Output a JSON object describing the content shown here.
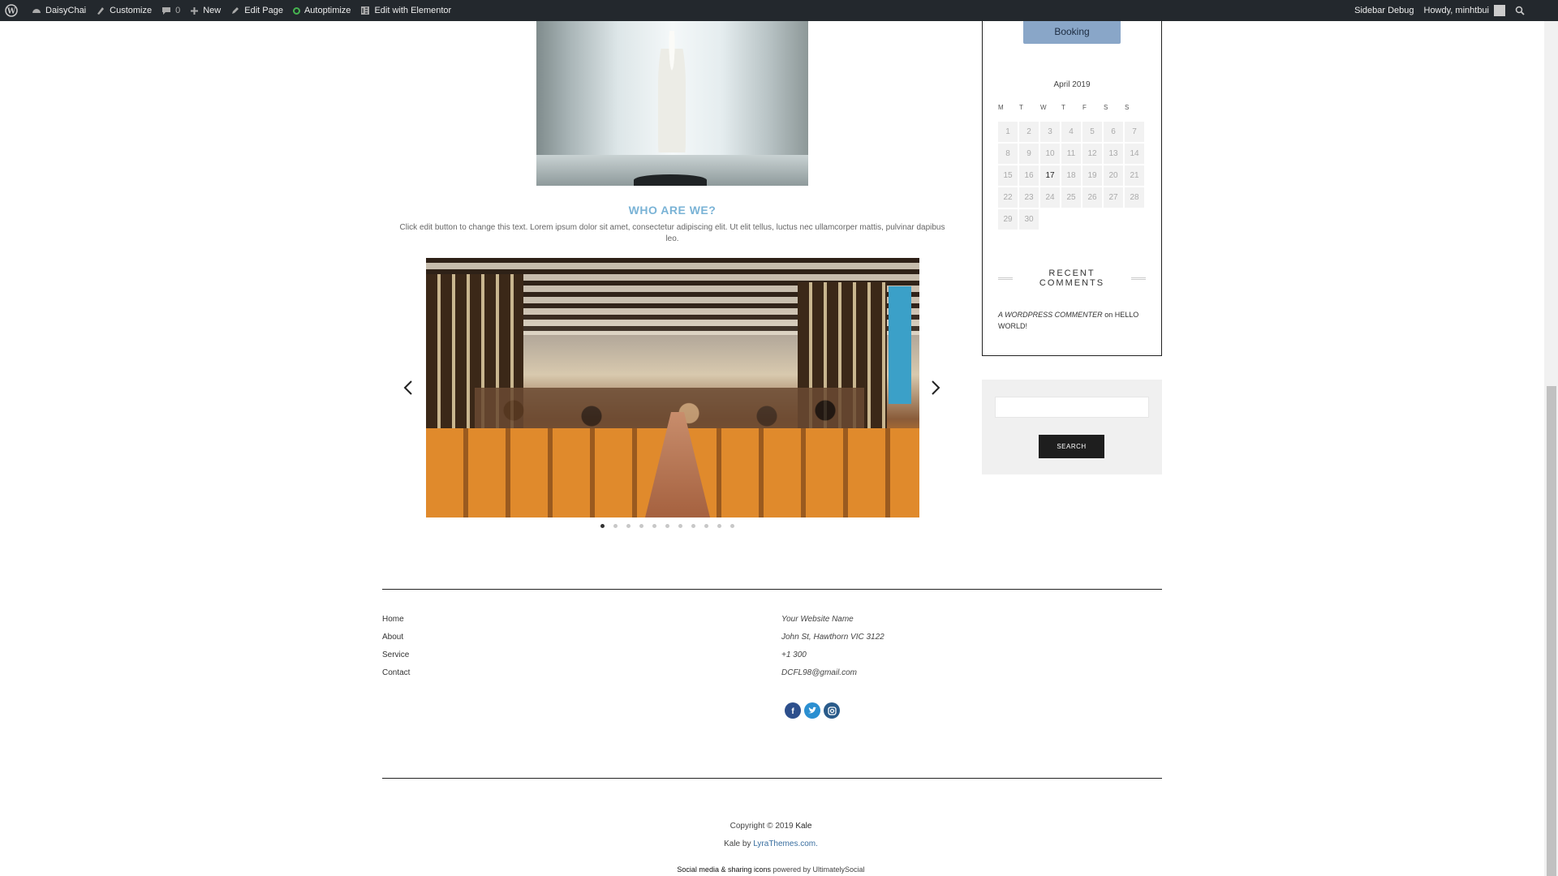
{
  "adminbar": {
    "site_name": "DaisyChai",
    "customize": "Customize",
    "comments_count": "0",
    "new": "New",
    "edit_page": "Edit Page",
    "autoptimize": "Autoptimize",
    "elementor": "Edit with Elementor",
    "sidebar_debug": "Sidebar Debug",
    "howdy": "Howdy, minhtbui"
  },
  "main": {
    "section_title": "WHO ARE WE?",
    "section_text": "Click edit button to change this text. Lorem ipsum dolor sit amet, consectetur adipiscing elit. Ut elit tellus, luctus nec ullamcorper mattis, pulvinar dapibus leo.",
    "slider": {
      "slide_count": 11,
      "active_index": 0
    }
  },
  "sidebar": {
    "booking_label": "Booking",
    "calendar": {
      "caption": "April 2019",
      "weekdays": [
        "M",
        "T",
        "W",
        "T",
        "F",
        "S",
        "S"
      ],
      "days": [
        "1",
        "2",
        "3",
        "4",
        "5",
        "6",
        "7",
        "8",
        "9",
        "10",
        "11",
        "12",
        "13",
        "14",
        "15",
        "16",
        "17",
        "18",
        "19",
        "20",
        "21",
        "22",
        "23",
        "24",
        "25",
        "26",
        "27",
        "28",
        "29",
        "30"
      ],
      "today": "17"
    },
    "recent_comments": {
      "title": "RECENT COMMENTS",
      "author": "A WORDPRESS COMMENTER",
      "on": "on",
      "post": "HELLO WORLD!"
    },
    "search": {
      "button_label": "SEARCH",
      "placeholder": ""
    }
  },
  "footer": {
    "links": [
      "Home",
      "About",
      "Service",
      "Contact"
    ],
    "info": {
      "name": "Your Website Name",
      "address": "John St, Hawthorn VIC 3122",
      "phone": "+1 300",
      "email": "DCFL98@gmail.com"
    },
    "social": [
      "facebook-icon",
      "twitter-icon",
      "instagram-icon"
    ],
    "copyright": "Copyright © 2019",
    "copyright_brand": "Kale",
    "credit_prefix": "Kale by",
    "credit_link": "LyraThemes.com.",
    "social_plugin_link": "Social media & sharing icons",
    "social_plugin_suffix": "powered by UltimatelySocial"
  },
  "colors": {
    "adminbar_bg": "#23282d",
    "accent_title": "#7ab3d6",
    "booking_button": "#89a6c8",
    "search_button": "#1e1e1e"
  }
}
